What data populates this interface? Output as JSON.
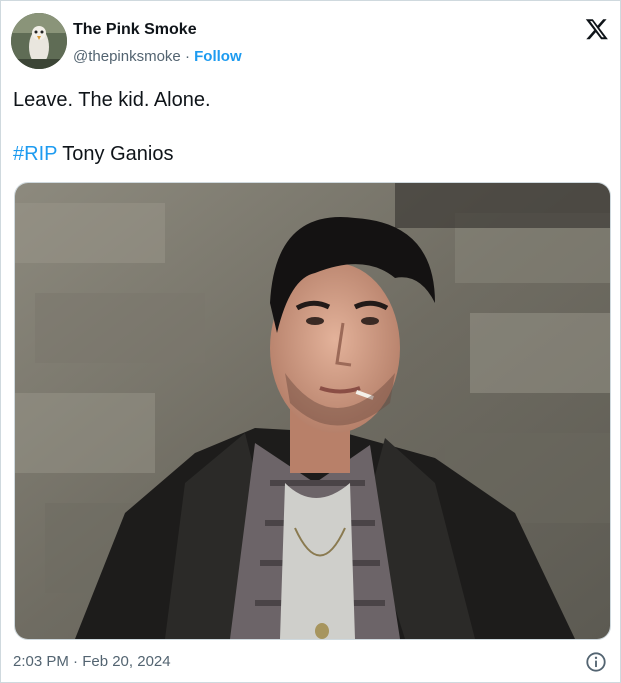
{
  "author": {
    "name": "The Pink Smoke",
    "handle": "@thepinksmoke",
    "separator": " · ",
    "follow_label": "Follow"
  },
  "tweet": {
    "line1": "Leave. The kid. Alone.",
    "hashtag": "#RIP",
    "line2_rest": " Tony Ganios"
  },
  "footer": {
    "timestamp": "2:03 PM · Feb 20, 2024"
  },
  "icons": {
    "brand": "x-logo-icon",
    "info": "info-icon"
  },
  "colors": {
    "accent": "#1d9bf0",
    "text": "#0f1419",
    "muted": "#536471"
  }
}
